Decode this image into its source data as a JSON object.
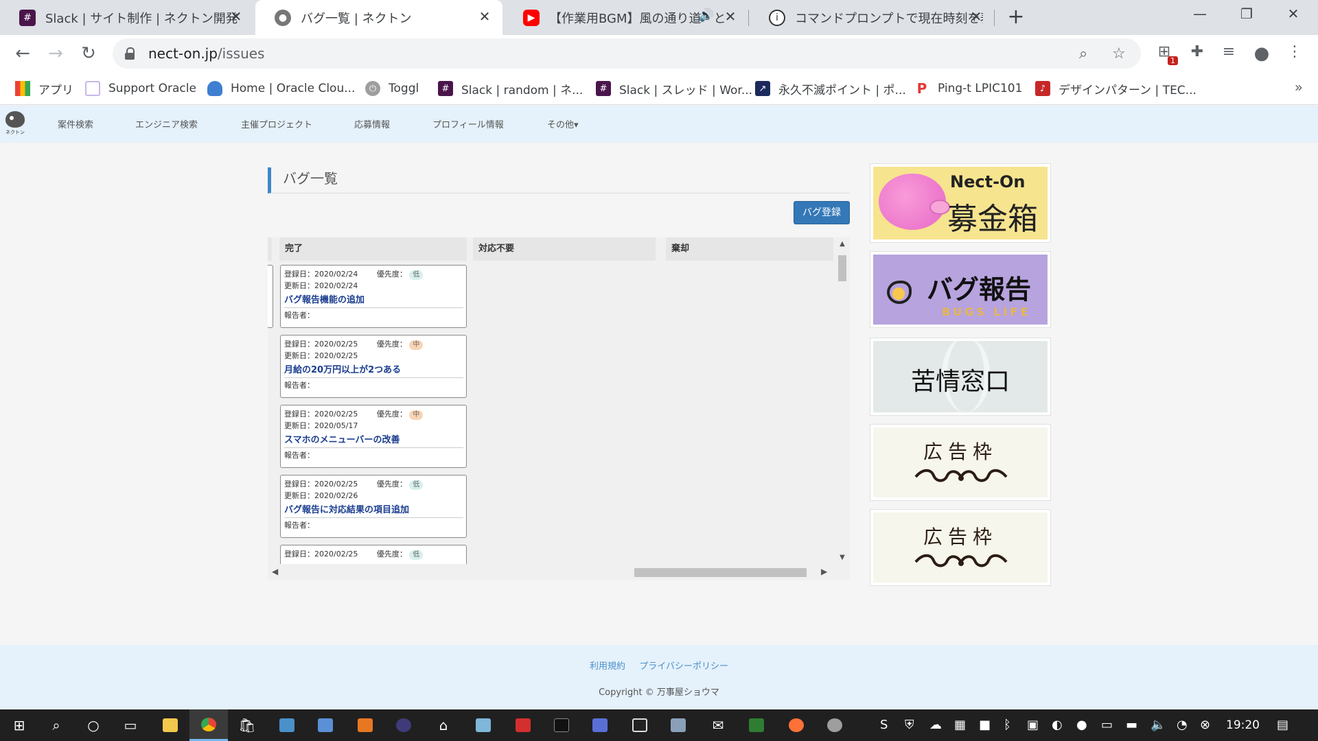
{
  "browser": {
    "tabs": [
      {
        "title": "Slack | サイト制作 | ネクトン開発",
        "icon": "slack-icon",
        "active": false
      },
      {
        "title": "バグ一覧 | ネクトン",
        "icon": "nekton-icon",
        "active": true
      },
      {
        "title": "【作業用BGM】風の通り道 - と",
        "icon": "youtube-icon",
        "active": false
      },
      {
        "title": "コマンドプロンプトで現在時刻を表示",
        "icon": "info-icon",
        "active": false
      }
    ],
    "url_host": "nect-on.jp",
    "url_path": "/issues",
    "extension_badge": "1",
    "bookmarks": [
      {
        "label": "アプリ",
        "icon": "apps-grid-icon"
      },
      {
        "label": "Support Oracle",
        "icon": "oracle-support-icon"
      },
      {
        "label": "Home | Oracle Clou...",
        "icon": "cloud-icon"
      },
      {
        "label": "Toggl",
        "icon": "toggl-icon"
      },
      {
        "label": "Slack | random | ネ...",
        "icon": "slack-icon"
      },
      {
        "label": "Slack | スレッド | Wor...",
        "icon": "slack-icon"
      },
      {
        "label": "永久不滅ポイント | ポ...",
        "icon": "chart-icon"
      },
      {
        "label": "Ping-t LPIC101",
        "icon": "ping-t-icon"
      },
      {
        "label": "デザインパターン | TEC...",
        "icon": "music-note-icon"
      }
    ]
  },
  "site": {
    "logo_caption": "ネクトン",
    "nav": [
      "案件検索",
      "エンジニア検索",
      "主催プロジェクト",
      "応募情報",
      "プロフィール情報",
      "その他▾"
    ],
    "page_title": "バグ一覧",
    "register_button": "バグ登録",
    "columns": [
      "完了",
      "対応不要",
      "棄却"
    ],
    "cards": [
      {
        "registered": "登録日：2020/02/24",
        "updated": "更新日：2020/02/24",
        "priority_label": "優先度：",
        "priority": "低",
        "title": "バグ報告機能の追加",
        "reporter": "報告者："
      },
      {
        "registered": "登録日：2020/02/25",
        "updated": "更新日：2020/02/25",
        "priority_label": "優先度：",
        "priority": "中",
        "title": "月給の20万円以上が2つある",
        "reporter": "報告者："
      },
      {
        "registered": "登録日：2020/02/25",
        "updated": "更新日：2020/05/17",
        "priority_label": "優先度：",
        "priority": "中",
        "title": "スマホのメニューバーの改善",
        "reporter": "報告者："
      },
      {
        "registered": "登録日：2020/02/25",
        "updated": "更新日：2020/02/26",
        "priority_label": "優先度：",
        "priority": "低",
        "title": "バグ報告に対応結果の項目追加",
        "reporter": "報告者："
      },
      {
        "registered": "登録日：2020/02/25",
        "updated": "",
        "priority_label": "優先度：",
        "priority": "低",
        "title": "",
        "reporter": ""
      }
    ],
    "priority_colors": {
      "低": "#d6f0ee",
      "中": "#f9d5b4"
    },
    "banners": {
      "donation_brand": "Nect-On",
      "donation_title": "募金箱",
      "bug_title": "バグ報告",
      "bug_subtitle": "BUGS LIFE",
      "complaint_title": "苦情窓口",
      "ad1": "広告枠",
      "ad2": "広告枠"
    },
    "footer": {
      "terms": "利用規約",
      "privacy": "プライバシーポリシー",
      "copyright": "Copyright © 万事屋ショウマ"
    }
  },
  "taskbar": {
    "clock": "19:20"
  }
}
